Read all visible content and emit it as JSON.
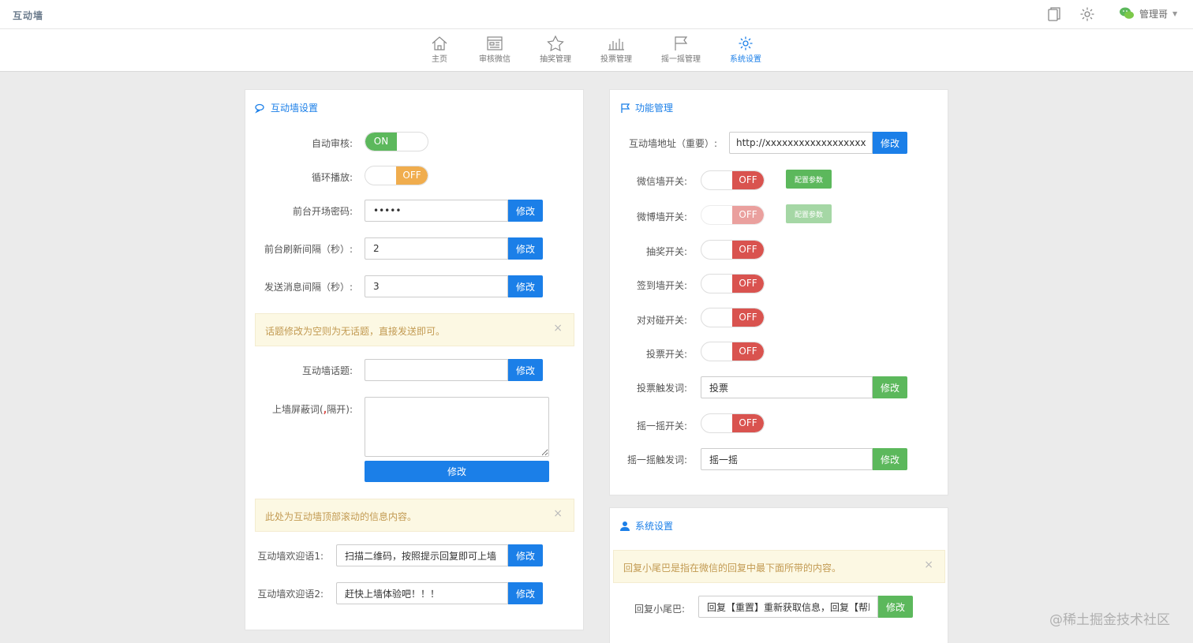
{
  "header": {
    "logo": "互动墙",
    "user_name": "管理哥",
    "icons": [
      "document-icon",
      "gear-icon",
      "wechat-icon"
    ]
  },
  "nav": {
    "items": [
      {
        "label": "主页",
        "icon": "home-icon"
      },
      {
        "label": "审核微信",
        "icon": "review-icon"
      },
      {
        "label": "抽奖管理",
        "icon": "star-icon"
      },
      {
        "label": "投票管理",
        "icon": "bar-chart-icon"
      },
      {
        "label": "摇一摇管理",
        "icon": "flag-icon"
      },
      {
        "label": "系统设置",
        "icon": "gear-icon",
        "active": true
      }
    ]
  },
  "wall_settings": {
    "title": "互动墙设置",
    "auto_review_label": "自动审核:",
    "auto_review_state": "ON",
    "loop_play_label": "循环播放:",
    "loop_play_state": "OFF",
    "password_label": "前台开场密码:",
    "password_value": "•••••",
    "refresh_label": "前台刷新间隔（秒）:",
    "refresh_value": "2",
    "send_label": "发送消息间隔（秒）:",
    "send_value": "3",
    "topic_alert": "话题修改为空则为无话题，直接发送即可。",
    "topic_label": "互动墙话题:",
    "topic_value": "",
    "block_label": "上墙屏蔽词(",
    "block_comma": ",",
    "block_label_end": "隔开):",
    "block_value": "",
    "scroll_alert": "此处为互动墙顶部滚动的信息内容。",
    "welcome1_label": "互动墙欢迎语1:",
    "welcome1_value": "扫描二维码，按照提示回复即可上墙",
    "welcome2_label": "互动墙欢迎语2:",
    "welcome2_value": "赶快上墙体验吧！！！",
    "modify": "修改",
    "close": "×"
  },
  "features": {
    "title": "功能管理",
    "address_label": "互动墙地址（重要）:",
    "address_value": "http://xxxxxxxxxxxxxxxxxxxxxxx",
    "wechat_wall_label": "微信墙开关:",
    "weibo_wall_label": "微博墙开关:",
    "lottery_label": "抽奖开关:",
    "signin_label": "签到墙开关:",
    "pair_label": "对对碰开关:",
    "vote_label": "投票开关:",
    "vote_trigger_label": "投票触发词:",
    "vote_trigger_value": "投票",
    "shake_label": "摇一摇开关:",
    "shake_trigger_label": "摇一摇触发词:",
    "shake_trigger_value": "摇一摇",
    "config": "配置参数",
    "off": "OFF",
    "modify": "修改"
  },
  "system": {
    "title": "系统设置",
    "alert": "回复小尾巴是指在微信的回复中最下面所带的内容。",
    "tail_label": "回复小尾巴:",
    "tail_value": "回复【重置】重新获取信息，回复【帮助】",
    "modify": "修改",
    "close": "×"
  },
  "watermark": "@稀土掘金技术社区",
  "colors": {
    "accent": "#1b7fe8",
    "success": "#5cb85c",
    "danger": "#d9534f",
    "warning": "#f0ad4e"
  }
}
